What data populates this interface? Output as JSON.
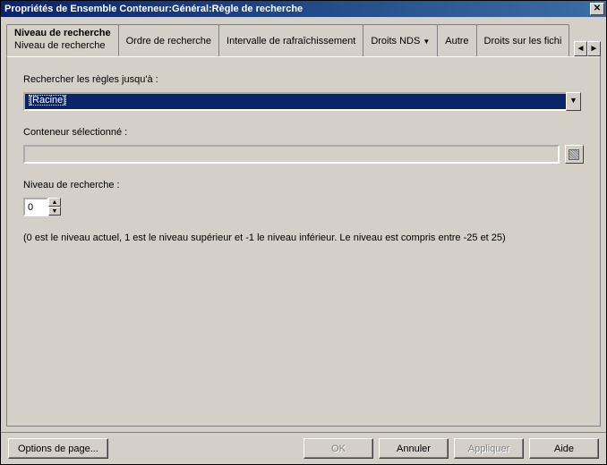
{
  "window": {
    "title": "Propriétés de Ensemble Conteneur:Général:Règle de recherche"
  },
  "tabs": {
    "active": {
      "label": "Niveau de recherche",
      "subline": "Niveau de recherche"
    },
    "items": [
      "Ordre de recherche",
      "Intervalle de rafraîchissement",
      "Droits NDS",
      "Autre",
      "Droits sur les fichi"
    ]
  },
  "form": {
    "search_rules_label": "Rechercher les règles jusqu'à :",
    "search_rules_value": "[Racine]",
    "selected_container_label": "Conteneur sélectionné :",
    "selected_container_value": "",
    "search_level_label": "Niveau de recherche :",
    "search_level_value": "0",
    "hint": "(0 est le niveau actuel, 1 est le niveau supérieur et -1 le niveau inférieur. Le niveau est compris entre -25 et 25)"
  },
  "buttons": {
    "page_options": "Options de page...",
    "ok": "OK",
    "cancel": "Annuler",
    "apply": "Appliquer",
    "help": "Aide"
  }
}
